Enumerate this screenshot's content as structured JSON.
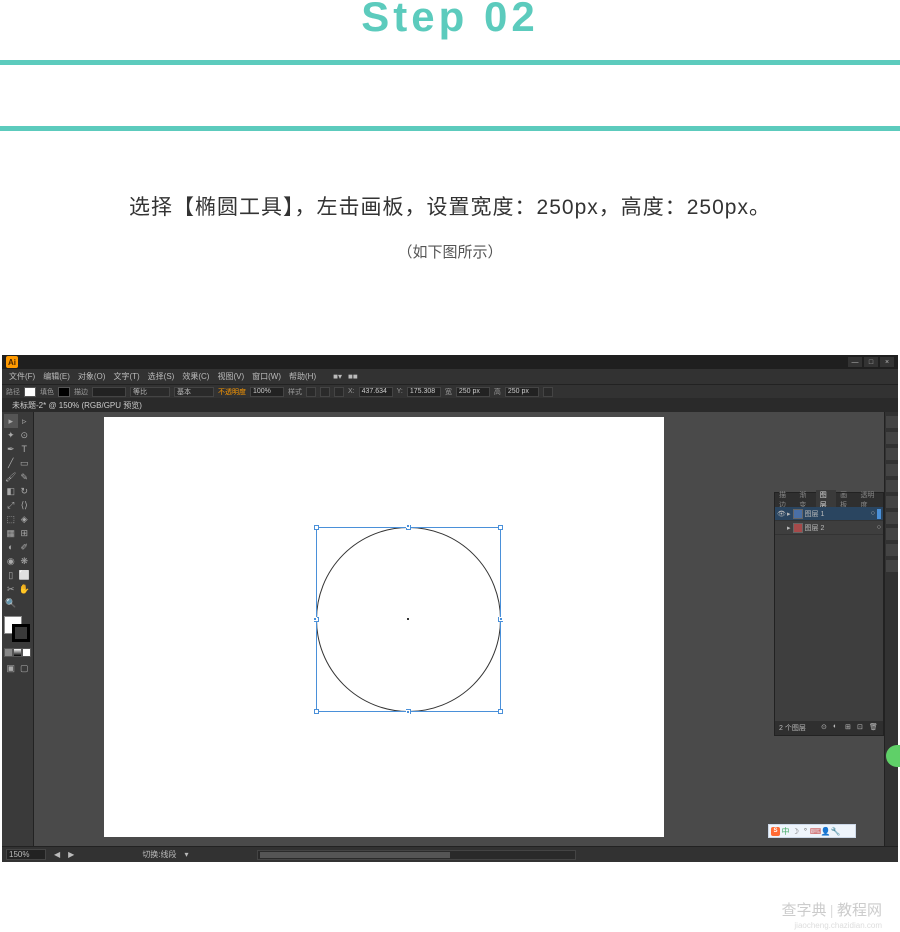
{
  "header": {
    "step_title": "Step 02"
  },
  "instruction": {
    "main": "选择【椭圆工具】，左击画板，设置宽度：250px，高度：250px。",
    "sub": "（如下图所示）"
  },
  "app": {
    "logo": "Ai",
    "menus": [
      "文件(F)",
      "编辑(E)",
      "对象(O)",
      "文字(T)",
      "选择(S)",
      "效果(C)",
      "视图(V)",
      "窗口(W)",
      "帮助(H)"
    ],
    "menu_extras": [
      "■▾",
      "■■"
    ],
    "window_controls": [
      "—",
      "□",
      "×"
    ]
  },
  "options": {
    "label_path": "路径",
    "label_fill": "填色",
    "label_stroke": "描边",
    "stroke_weight": "",
    "profile_label": "等比",
    "basic_label": "基本",
    "opacity_label": "不透明度",
    "opacity_value": "100%",
    "style_label": "样式",
    "x_label": "X:",
    "x_value": "437.634",
    "y_label": "Y:",
    "y_value": "175.308",
    "w_label": "宽",
    "w_value": "250 px",
    "h_label": "高",
    "h_value": "250 px"
  },
  "document": {
    "tab": "未标题-2* @ 150% (RGB/GPU 预览)"
  },
  "layers_panel": {
    "tabs": [
      "描边",
      "渐变",
      "图层",
      "画板",
      "透明度"
    ],
    "active_tab": "图层",
    "rows": [
      {
        "name": "图层 1",
        "color": "blue"
      },
      {
        "name": "图层 2",
        "color": "red"
      }
    ],
    "footer_text": "2 个图层"
  },
  "ime": {
    "logo": "S",
    "text": "中"
  },
  "status": {
    "zoom": "150%",
    "tool_hint": "切换:线段"
  },
  "watermark": {
    "main": "查字典 | 教程网",
    "sub": "jiaocheng.chazidian.com"
  }
}
